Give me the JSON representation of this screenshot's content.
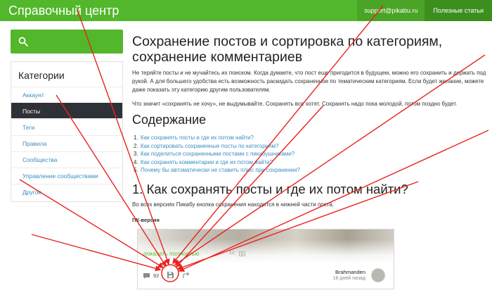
{
  "header": {
    "brand": "Справочный центр",
    "email": "support@pikabu.ru",
    "articles": "Полезные статьи"
  },
  "sidebar": {
    "title": "Категории",
    "items": [
      {
        "label": "Аккаунт",
        "active": false
      },
      {
        "label": "Посты",
        "active": true
      },
      {
        "label": "Теги",
        "active": false
      },
      {
        "label": "Правила",
        "active": false
      },
      {
        "label": "Сообщества",
        "active": false
      },
      {
        "label": "Управление сообществами",
        "active": false
      },
      {
        "label": "Другое",
        "active": false
      }
    ]
  },
  "article": {
    "title": "Сохранение постов и сортировка по категориям, сохранение комментариев",
    "intro": "Не теряйте посты и не мучайтесь их поиском. Когда думаете, что пост еще пригодится в будущем, можно его сохранить и держать под рукой. А для большего удобства есть возможность раскидать сохраненное по тематическим категориям. Если будет желание, можете даже показать эту категорию другим пользователям.",
    "intro2": "Что значит «сохранять не хочу», не выдумывайте. Сохранять все хотят. Сохранять надо пока молодой, потом поздно будет.",
    "toc_title": "Содержание",
    "toc": [
      {
        "num": "1.",
        "text": "Как сохранять посты и где их потом найти?"
      },
      {
        "num": "2.",
        "text": "Как сортировать сохраненные посты по категориям?"
      },
      {
        "num": "3.",
        "text": "Как поделиться сохраненными постами с пикабушниками?"
      },
      {
        "num": "4.",
        "text": "Как сохранять комментарии и где их потом найти?"
      },
      {
        "num": "5.",
        "text": "Почему бы автоматически не ставить плюс при сохранении?"
      }
    ],
    "section_title": "1. Как сохранять посты и где их потом найти?",
    "section_para": "Во всех версиях Пикабу кнопка сохранения находится в нижней части поста.",
    "pc_label": "ПК-версия"
  },
  "post": {
    "show_full": "показать полностью",
    "image_count": "12",
    "comments": "92",
    "author": "Brahmanden",
    "time_ago": "18 дней назад"
  },
  "colors": {
    "brand_green": "#52b72a",
    "link_blue": "#3a8ec2",
    "active_item": "#2f3138",
    "annotation_red": "#e8231f"
  },
  "icons": [
    "search-icon",
    "comment-icon",
    "save-icon",
    "share-icon",
    "image-icon"
  ]
}
